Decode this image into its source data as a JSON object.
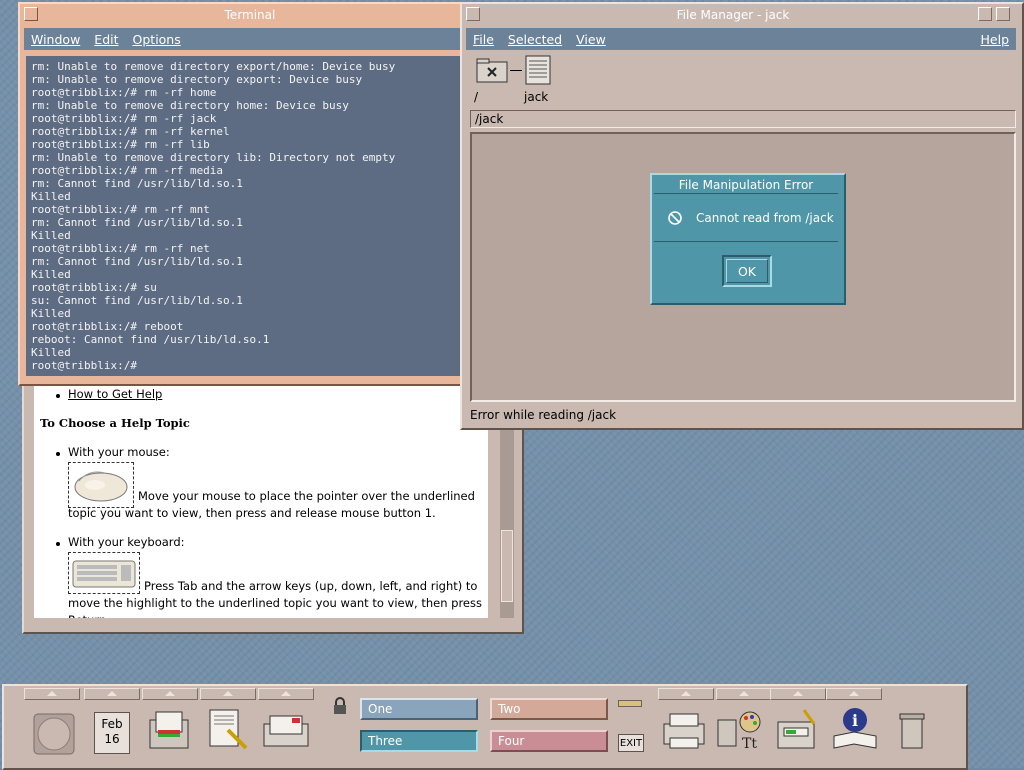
{
  "terminal": {
    "title": "Terminal",
    "menus": [
      "Window",
      "Edit",
      "Options"
    ],
    "lines": [
      "rm: Unable to remove directory export/home: Device busy",
      "rm: Unable to remove directory export: Device busy",
      "root@tribblix:/# rm -rf home",
      "rm: Unable to remove directory home: Device busy",
      "root@tribblix:/# rm -rf jack",
      "root@tribblix:/# rm -rf kernel",
      "root@tribblix:/# rm -rf lib",
      "rm: Unable to remove directory lib: Directory not empty",
      "root@tribblix:/# rm -rf media",
      "rm: Cannot find /usr/lib/ld.so.1",
      "Killed",
      "root@tribblix:/# rm -rf mnt",
      "rm: Cannot find /usr/lib/ld.so.1",
      "Killed",
      "root@tribblix:/# rm -rf net",
      "rm: Cannot find /usr/lib/ld.so.1",
      "Killed",
      "root@tribblix:/# su",
      "su: Cannot find /usr/lib/ld.so.1",
      "Killed",
      "root@tribblix:/# reboot",
      "reboot: Cannot find /usr/lib/ld.so.1",
      "Killed",
      "root@tribblix:/#"
    ]
  },
  "file_manager": {
    "title": "File Manager - jack",
    "menus": {
      "file": "File",
      "selected": "Selected",
      "view": "View",
      "help": "Help"
    },
    "path_icons": {
      "root_label": "/",
      "jack_label": "jack"
    },
    "path": "/jack",
    "status": "Error while reading /jack"
  },
  "error_dialog": {
    "title": "File Manipulation Error",
    "message": "Cannot read from /jack",
    "ok_label": "OK"
  },
  "help": {
    "link": "How to Get Help",
    "heading": "To Choose a Help Topic",
    "mouse_label": "With your mouse:",
    "mouse_text": "Move your mouse to place the pointer over the underlined topic you want to view, then press and release mouse button 1.",
    "keyboard_label": "With your keyboard:",
    "keyboard_text": "Press Tab and the arrow keys (up, down, left, and right) to move the highlight to the underlined topic you want to view, then press Return."
  },
  "front_panel": {
    "date_month": "Feb",
    "date_day": "16",
    "workspaces": [
      "One",
      "Two",
      "Three",
      "Four"
    ],
    "exit_label": "EXIT",
    "icons": [
      "clock-icon",
      "calendar-icon",
      "file-manager-icon",
      "text-editor-icon",
      "mailer-icon",
      "lock-icon",
      "printer-icon",
      "style-manager-icon",
      "app-manager-icon",
      "help-manager-icon",
      "trash-icon"
    ]
  },
  "colors": {
    "terminal_bg": "#5d6b83",
    "menubar": "#6b8299",
    "dialog": "#4f97a8",
    "frame": "#c9b9b1",
    "active_frame": "#e8b79b"
  }
}
